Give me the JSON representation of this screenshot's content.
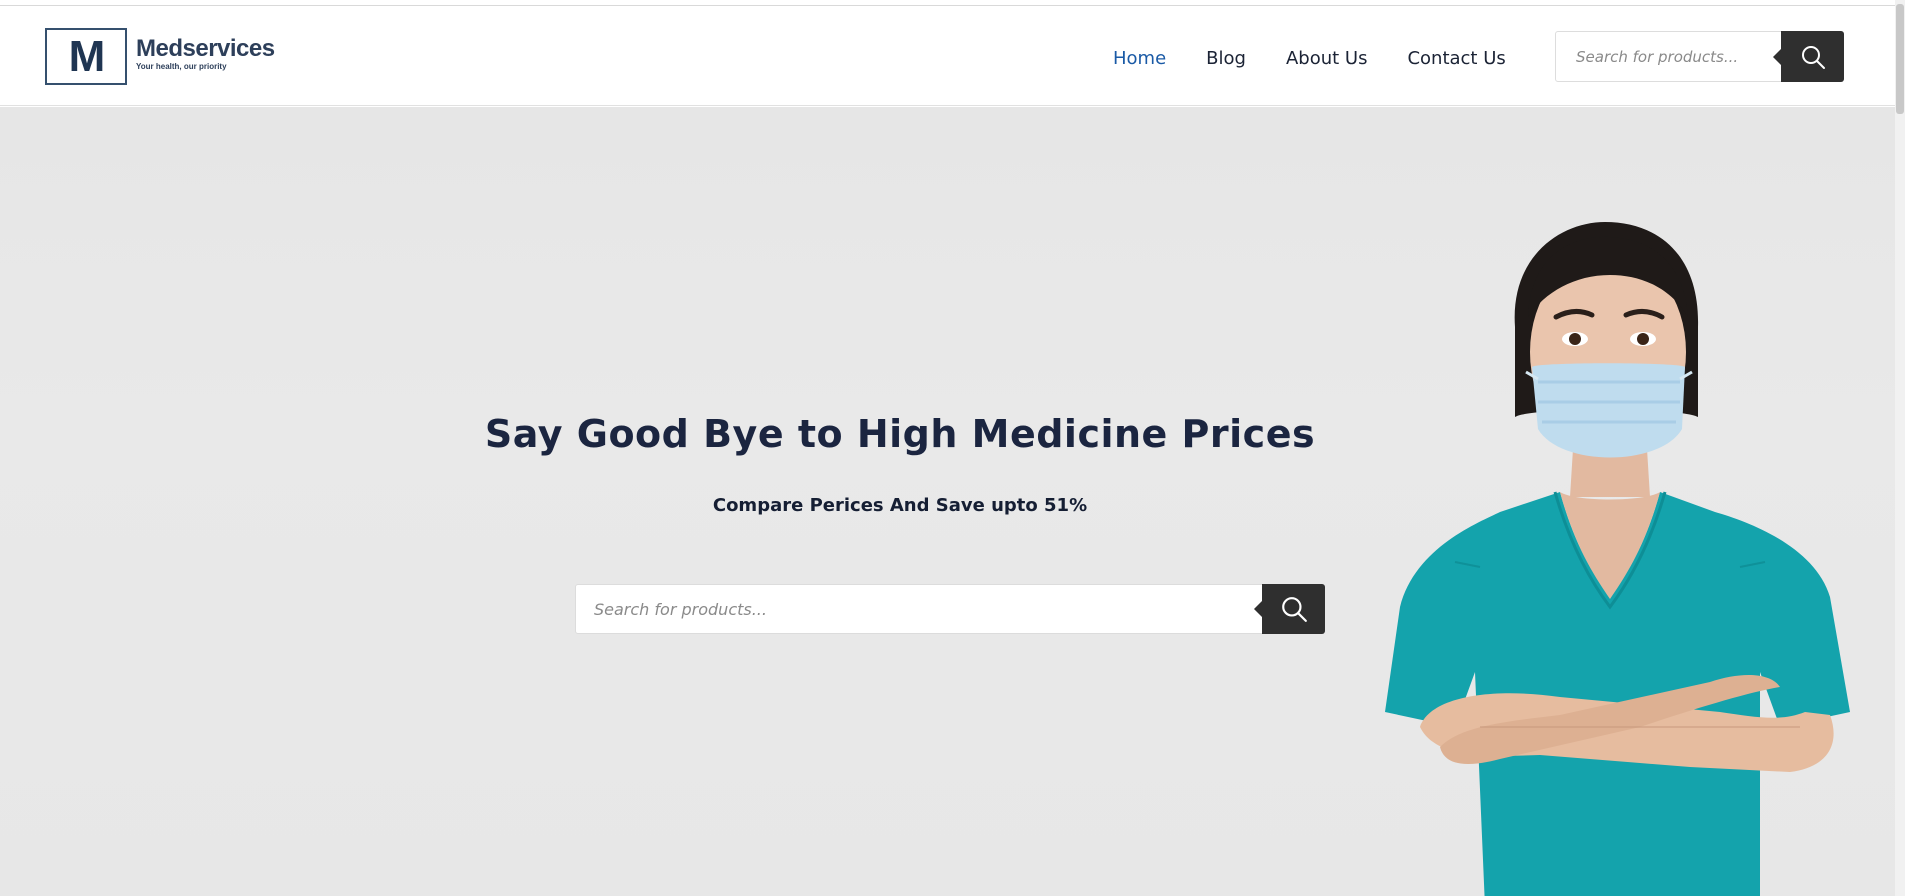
{
  "brand": {
    "logo_letter": "M",
    "name": "Medservices",
    "tagline": "Your health, our priority",
    "colors": {
      "primary": "#2d3f5a",
      "accent": "#1a5aa6"
    }
  },
  "nav": {
    "items": [
      {
        "label": "Home",
        "active": true
      },
      {
        "label": "Blog",
        "active": false
      },
      {
        "label": "About Us",
        "active": false
      },
      {
        "label": "Contact Us",
        "active": false
      }
    ]
  },
  "header_search": {
    "placeholder": "Search for products...",
    "button_icon": "search-icon"
  },
  "hero": {
    "title": "Say Good Bye to High Medicine Prices",
    "subtitle": "Compare Perices And Save upto 51%",
    "search": {
      "placeholder": "Search for products...",
      "button_icon": "search-icon"
    },
    "image": "nurse-with-face-mask"
  }
}
